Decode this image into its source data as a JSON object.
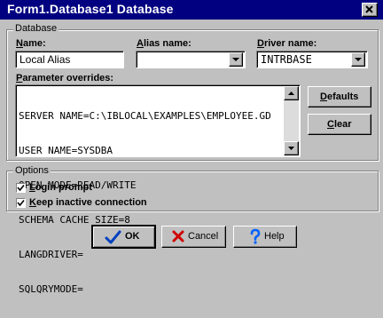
{
  "window": {
    "title": "Form1.Database1 Database"
  },
  "database_group": {
    "label": "Database",
    "name_label_u": "N",
    "name_label_rest": "ame:",
    "name_value": "Local Alias",
    "alias_label_u": "A",
    "alias_label_rest": "lias name:",
    "alias_value": "",
    "driver_label_u": "D",
    "driver_label_rest": "river name:",
    "driver_value": "INTRBASE",
    "params_label_u": "P",
    "params_label_rest": "arameter overrides:",
    "params_lines": [
      "SERVER NAME=C:\\IBLOCAL\\EXAMPLES\\EMPLOYEE.GD",
      "USER NAME=SYSDBA",
      "OPEN MODE=READ/WRITE",
      "SCHEMA CACHE SIZE=8",
      "LANGDRIVER=",
      "SQLQRYMODE="
    ],
    "defaults_button_u": "D",
    "defaults_button_rest": "efaults",
    "clear_button_u": "C",
    "clear_button_rest": "lear"
  },
  "options_group": {
    "label": "Options",
    "login_prompt_u": "L",
    "login_prompt_rest": "ogin prompt",
    "login_prompt_checked": true,
    "keep_connection_u": "K",
    "keep_connection_rest": "eep inactive connection",
    "keep_connection_checked": true
  },
  "buttons": {
    "ok": "OK",
    "cancel": "Cancel",
    "help": "Help"
  },
  "icons": {
    "ok": "checkmark-icon",
    "cancel": "red-x-icon",
    "help": "question-mark-icon",
    "close": "close-icon",
    "dropdown": "chevron-down-icon"
  },
  "colors": {
    "title_bar": "#000080",
    "dialog_face": "#c0c0c0",
    "ok_icon": "#0040c0",
    "cancel_icon": "#d00000",
    "help_icon": "#0060ff"
  }
}
